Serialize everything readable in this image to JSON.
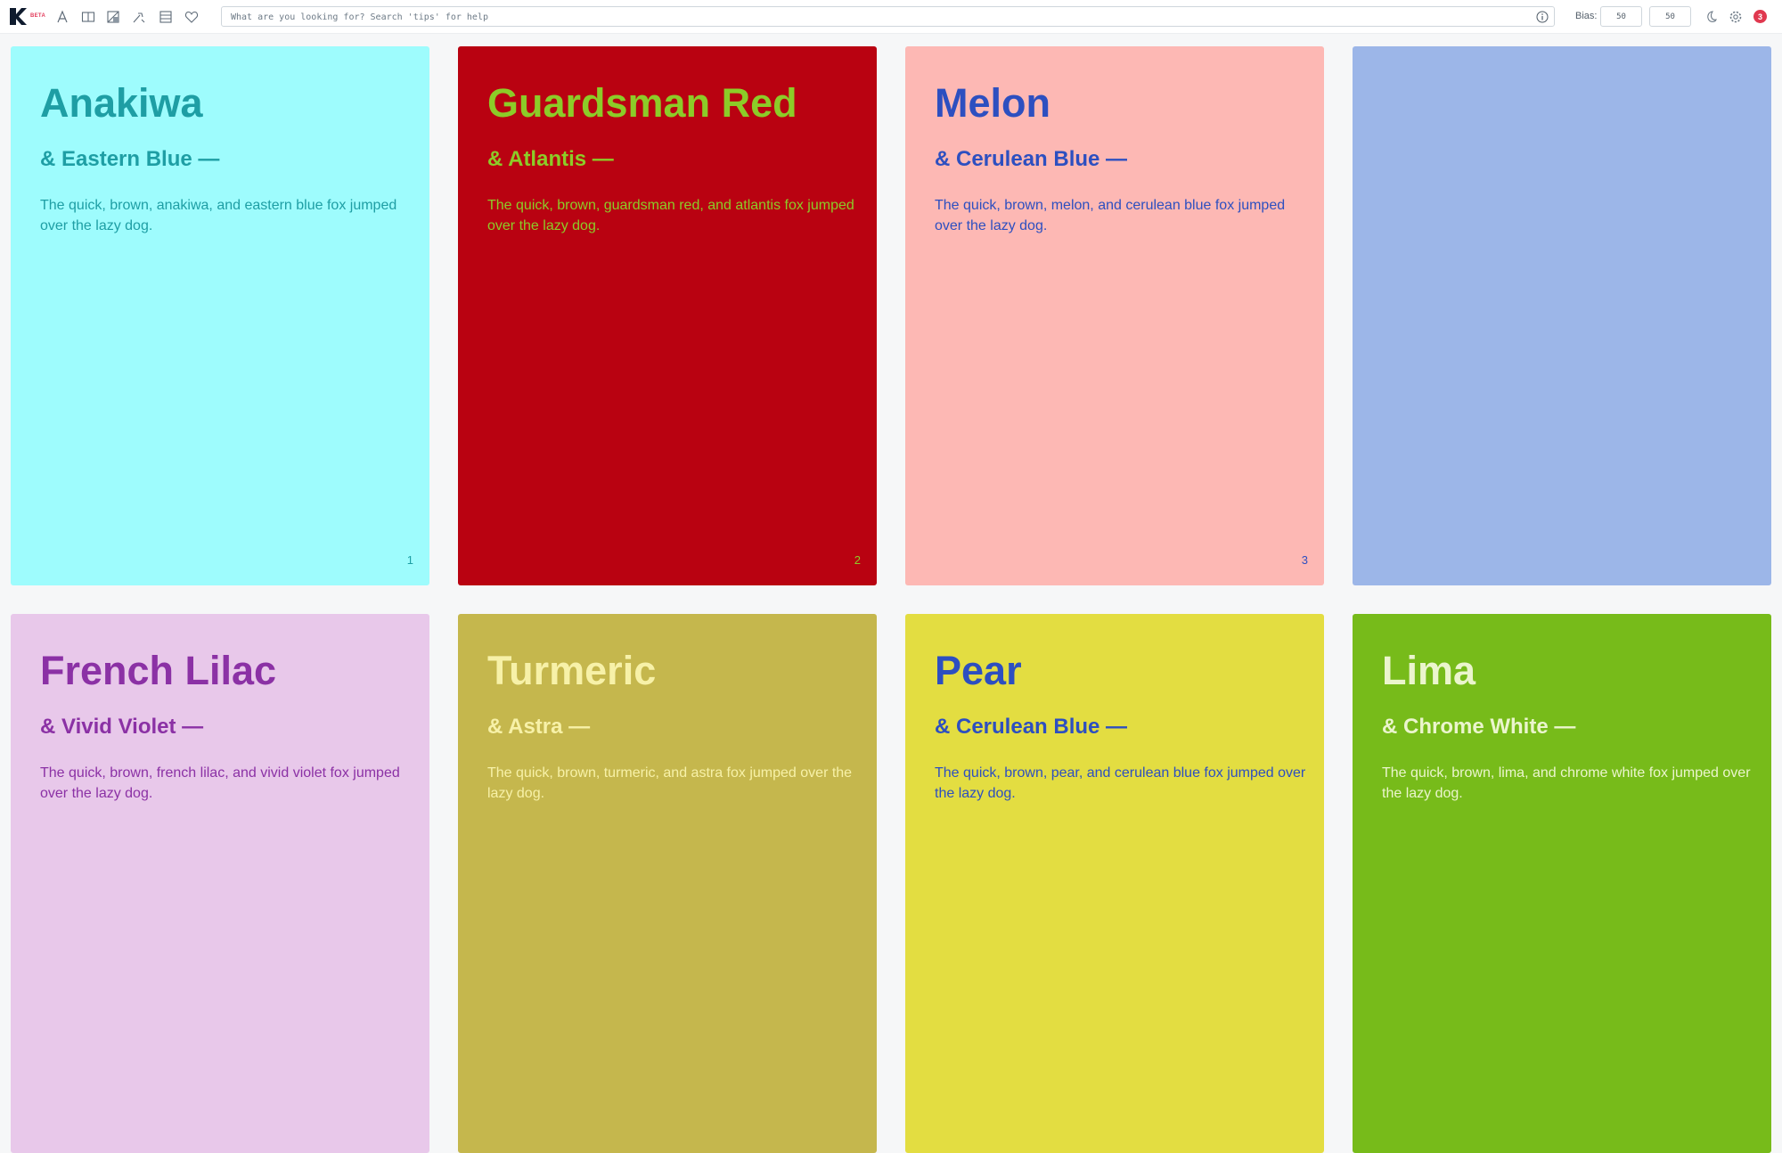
{
  "toolbar": {
    "beta_label": "BETA",
    "icons": [
      "typography-icon",
      "split-view-icon",
      "image-icon",
      "gradient-icon",
      "palette-list-icon",
      "heart-icon"
    ]
  },
  "search": {
    "placeholder": "What are you looking for? Search 'tips' for help",
    "value": ""
  },
  "bias": {
    "label": "Bias:",
    "value1": "50",
    "value2": "50"
  },
  "notifications": {
    "count": "3"
  },
  "cards": [
    {
      "title": "Anakiwa",
      "subtitle": "& Eastern Blue —",
      "body": "The quick, brown, anakiwa, and eastern blue fox jumped over the lazy dog.",
      "number": "1",
      "bg": "#9efcfd",
      "fg": "#1e9ea4"
    },
    {
      "title": "Guardsman Red",
      "subtitle": "& Atlantis —",
      "body": "The quick, brown, guardsman red, and atlantis fox jumped over the lazy dog.",
      "number": "2",
      "bg": "#b90211",
      "fg": "#8ccc28"
    },
    {
      "title": "Melon",
      "subtitle": "& Cerulean Blue —",
      "body": "The quick, brown, melon, and cerulean blue fox jumped over the lazy dog.",
      "number": "3",
      "bg": "#fdb8b4",
      "fg": "#2d4fc0"
    },
    {
      "title": "",
      "subtitle": "",
      "body": "",
      "number": "",
      "bg": "#9cb6e8",
      "fg": "#9cb6e8"
    },
    {
      "title": "French Lilac",
      "subtitle": "& Vivid Violet —",
      "body": "The quick, brown, french lilac, and vivid violet fox jumped over the lazy dog.",
      "number": "",
      "bg": "#e8c8ea",
      "fg": "#8b31a5"
    },
    {
      "title": "Turmeric",
      "subtitle": "& Astra —",
      "body": "The quick, brown, turmeric, and astra fox jumped over the lazy dog.",
      "number": "",
      "bg": "#c5b74d",
      "fg": "#f7f1a8"
    },
    {
      "title": "Pear",
      "subtitle": "& Cerulean Blue —",
      "body": "The quick, brown, pear, and cerulean blue fox jumped over the lazy dog.",
      "number": "",
      "bg": "#e3dd41",
      "fg": "#2d4fc0"
    },
    {
      "title": "Lima",
      "subtitle": "& Chrome White —",
      "body": "The quick, brown, lima, and chrome white fox jumped over the lazy dog.",
      "number": "",
      "bg": "#77bb1a",
      "fg": "#ebf5cd"
    }
  ]
}
